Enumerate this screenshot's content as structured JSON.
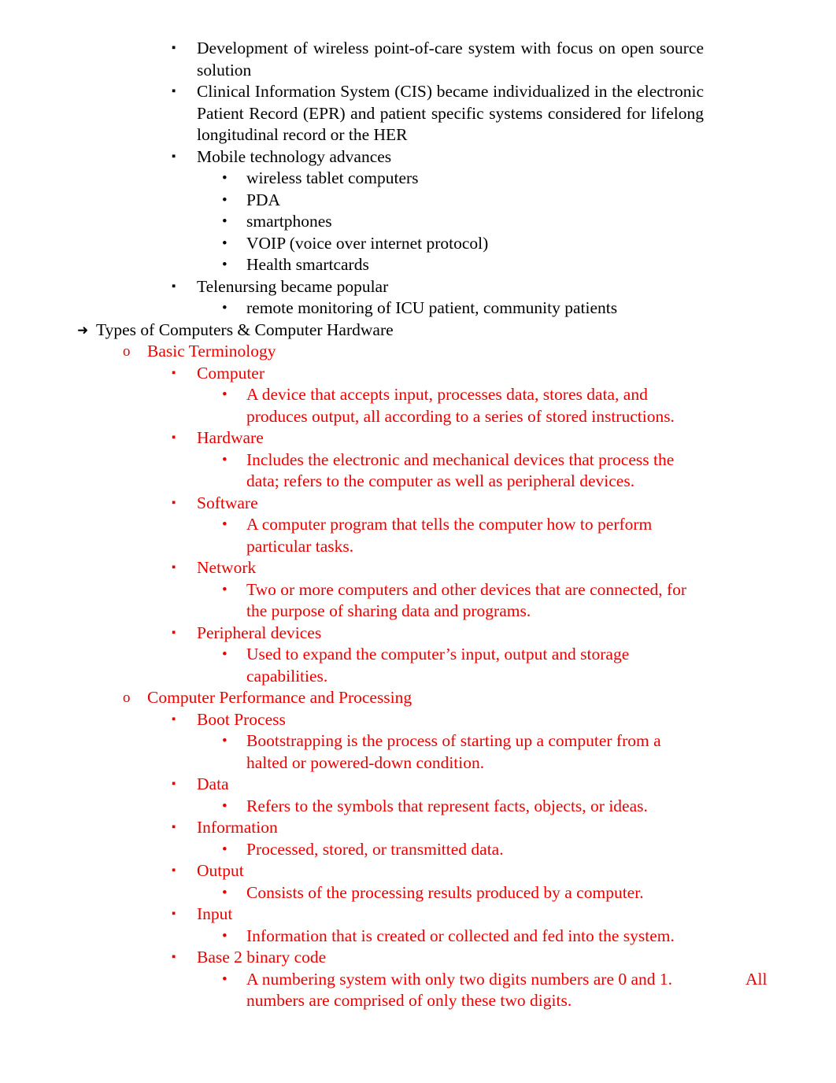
{
  "document": {
    "colors": {
      "text_black": "#000000",
      "text_red": "#EE0000",
      "page_background": "#FFFFFF"
    },
    "bullets": {
      "level1": "➜",
      "level2": "o",
      "level3": "▪",
      "level4": "•"
    },
    "outline": [
      {
        "id": "b1",
        "level": 3,
        "color": "black",
        "justify": true,
        "text": "Development of wireless point-of-care system with focus on open source solution"
      },
      {
        "id": "b2",
        "level": 3,
        "color": "black",
        "justify": true,
        "text": "Clinical Information System (CIS) became individualized in the electronic Patient Record (EPR) and patient specific systems considered for lifelong longitudinal record or the HER"
      },
      {
        "id": "b3",
        "level": 3,
        "color": "black",
        "justify": false,
        "text": "Mobile technology advances"
      },
      {
        "id": "b4",
        "level": 4,
        "color": "black",
        "justify": false,
        "text": "wireless tablet computers"
      },
      {
        "id": "b5",
        "level": 4,
        "color": "black",
        "justify": false,
        "text": "PDA"
      },
      {
        "id": "b6",
        "level": 4,
        "color": "black",
        "justify": false,
        "text": "smartphones"
      },
      {
        "id": "b7",
        "level": 4,
        "color": "black",
        "justify": false,
        "text": "VOIP (voice over internet protocol)"
      },
      {
        "id": "b8",
        "level": 4,
        "color": "black",
        "justify": false,
        "text": "Health smartcards"
      },
      {
        "id": "b9",
        "level": 3,
        "color": "black",
        "justify": false,
        "text": "Telenursing became popular"
      },
      {
        "id": "b10",
        "level": 4,
        "color": "black",
        "justify": false,
        "text": "remote monitoring of ICU patient, community patients"
      },
      {
        "id": "b11",
        "level": 1,
        "color": "black",
        "justify": false,
        "text": "Types of Computers & Computer Hardware"
      },
      {
        "id": "b12",
        "level": 2,
        "color": "red",
        "justify": false,
        "text": "Basic Terminology"
      },
      {
        "id": "b13",
        "level": 3,
        "color": "red",
        "justify": false,
        "text": "Computer"
      },
      {
        "id": "b14",
        "level": 4,
        "color": "red",
        "justify": false,
        "text": "A device that accepts input, processes data, stores data, and produces output, all according to a series of stored instructions."
      },
      {
        "id": "b15",
        "level": 3,
        "color": "red",
        "justify": false,
        "text": "Hardware"
      },
      {
        "id": "b16",
        "level": 4,
        "color": "red",
        "justify": false,
        "text": "Includes the electronic and mechanical devices that process the data; refers to the computer as well as peripheral devices."
      },
      {
        "id": "b17",
        "level": 3,
        "color": "red",
        "justify": false,
        "text": "Software"
      },
      {
        "id": "b18",
        "level": 4,
        "color": "red",
        "justify": false,
        "text": "A computer program that tells the computer how to perform particular tasks."
      },
      {
        "id": "b19",
        "level": 3,
        "color": "red",
        "justify": false,
        "text": "Network"
      },
      {
        "id": "b20",
        "level": 4,
        "color": "red",
        "justify": false,
        "text": "Two or more computers and other devices that are connected, for the purpose of sharing data and programs."
      },
      {
        "id": "b21",
        "level": 3,
        "color": "red",
        "justify": false,
        "text": "Peripheral devices"
      },
      {
        "id": "b22",
        "level": 4,
        "color": "red",
        "justify": false,
        "text": "Used to expand the computer’s input, output and storage capabilities."
      },
      {
        "id": "b23",
        "level": 2,
        "color": "red",
        "justify": false,
        "text": "Computer Performance and Processing"
      },
      {
        "id": "b24",
        "level": 3,
        "color": "red",
        "justify": false,
        "text": "Boot Process"
      },
      {
        "id": "b25",
        "level": 4,
        "color": "red",
        "justify": false,
        "text": "Bootstrapping is the process of starting up a computer from a halted or powered-down condition."
      },
      {
        "id": "b26",
        "level": 3,
        "color": "red",
        "justify": false,
        "text": "Data"
      },
      {
        "id": "b27",
        "level": 4,
        "color": "red",
        "justify": false,
        "text": "Refers to the symbols that represent facts, objects, or ideas."
      },
      {
        "id": "b28",
        "level": 3,
        "color": "red",
        "justify": false,
        "text": "Information"
      },
      {
        "id": "b29",
        "level": 4,
        "color": "red",
        "justify": false,
        "text": "Processed, stored, or transmitted data."
      },
      {
        "id": "b30",
        "level": 3,
        "color": "red",
        "justify": false,
        "text": "Output"
      },
      {
        "id": "b31",
        "level": 4,
        "color": "red",
        "justify": false,
        "text": "Consists of the processing results produced by a computer."
      },
      {
        "id": "b32",
        "level": 3,
        "color": "red",
        "justify": false,
        "text": "Input"
      },
      {
        "id": "b33",
        "level": 4,
        "color": "red",
        "justify": false,
        "text": "Information that is created or collected and fed into the system."
      },
      {
        "id": "b34",
        "level": 3,
        "color": "red",
        "justify": false,
        "text": "Base 2 binary code"
      },
      {
        "id": "b35",
        "level": 4,
        "color": "red",
        "justify": false,
        "text": "A numbering system with only two digits numbers are 0 and 1.",
        "trailing_right": "All",
        "continuation": "numbers are comprised of only these two digits."
      }
    ]
  }
}
